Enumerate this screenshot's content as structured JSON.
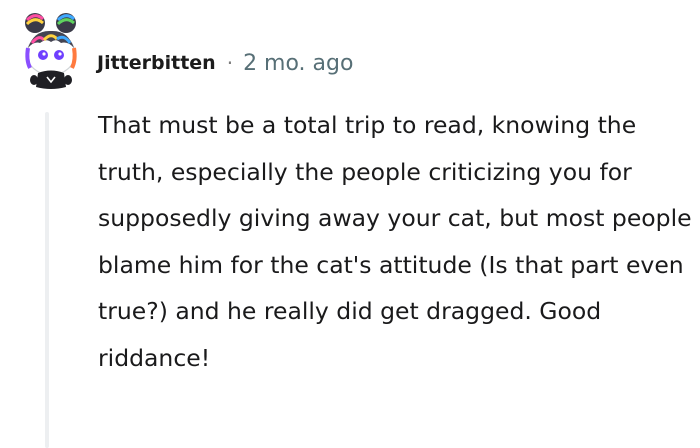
{
  "comment": {
    "username": "Jitterbitten",
    "separator": "·",
    "timestamp": "2 mo. ago",
    "body": "That must be a total trip to read, knowing the truth, especially the people criticizing you for supposedly giving away your cat, but most people blame him for the cat's attitude (Is that part even true?) and he really did get dragged. Good riddance!",
    "avatar_icon": "snoo-avatar-icon"
  },
  "colors": {
    "username": "#1c1c1c",
    "timestamp": "#576f76",
    "body_text": "#1a1a1b",
    "thread_line": "#edeff1"
  }
}
